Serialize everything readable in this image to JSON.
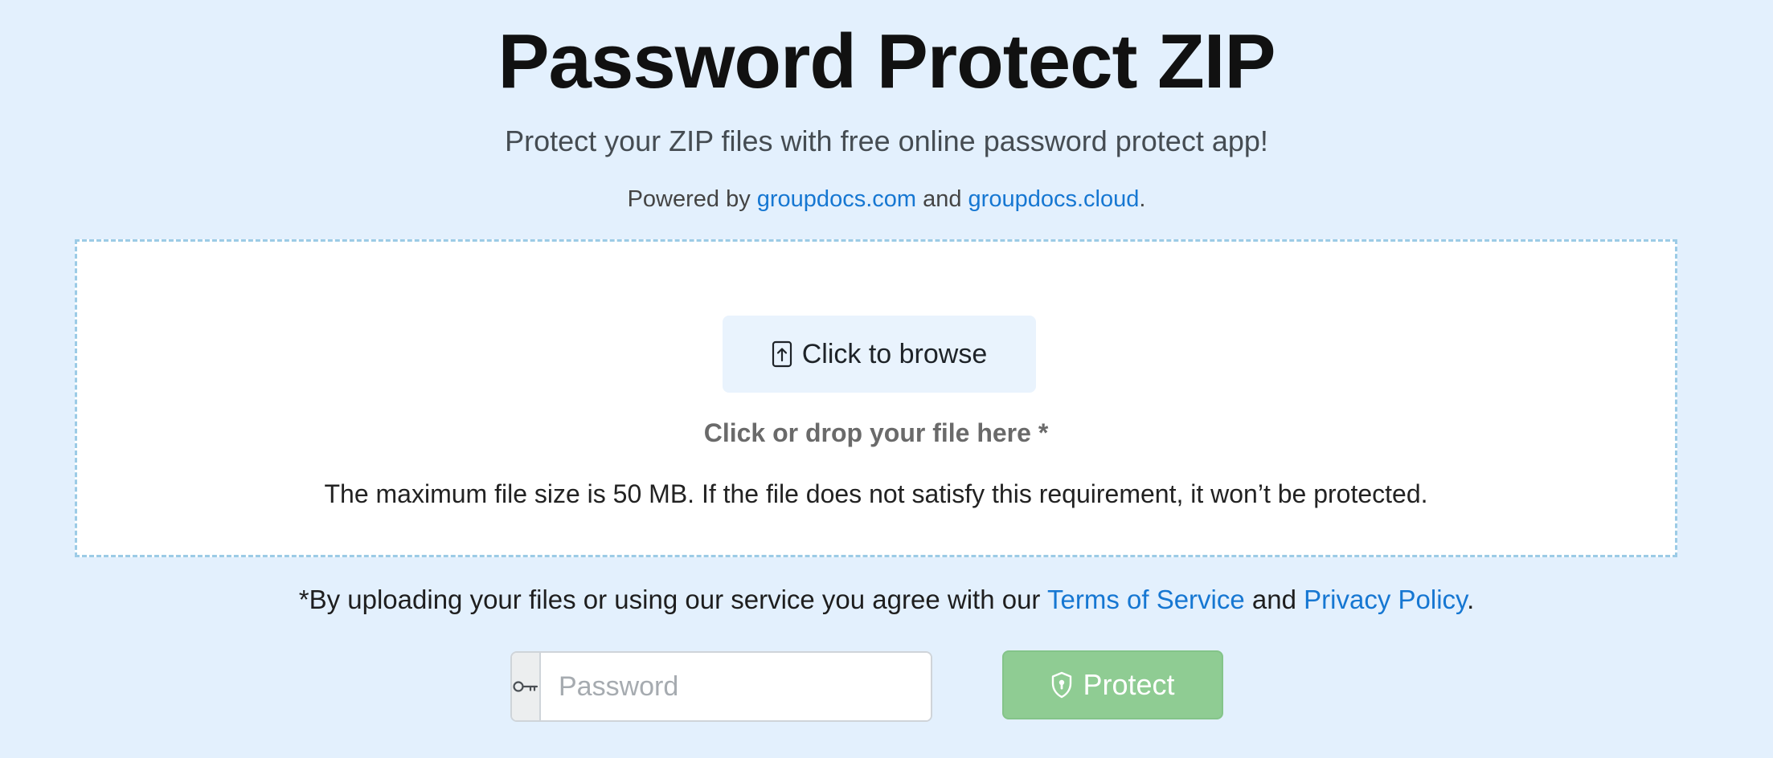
{
  "header": {
    "title": "Password Protect ZIP",
    "subtitle": "Protect your ZIP files with free online password protect app!",
    "powered_prefix": "Powered by ",
    "powered_link1": "groupdocs.com",
    "powered_middle": " and ",
    "powered_link2": "groupdocs.cloud",
    "powered_suffix": "."
  },
  "dropzone": {
    "browse_icon": "upload-file-icon",
    "browse_label": "Click to browse",
    "hint": "Click or drop your file here *",
    "size_note": "The maximum file size is 50 MB. If the file does not satisfy this requirement, it won’t be protected."
  },
  "agreement": {
    "prefix": "*By uploading your files or using our service you agree with our ",
    "terms_link": "Terms of Service",
    "middle": " and ",
    "privacy_link": "Privacy Policy",
    "suffix": "."
  },
  "form": {
    "key_icon": "key-icon",
    "password_placeholder": "Password",
    "password_value": "",
    "protect_icon": "shield-lock-icon",
    "protect_label": "Protect"
  },
  "colors": {
    "background": "#e3f0fd",
    "link": "#1677d2",
    "protect_button": "#8fcc93",
    "dropzone_border": "#9ccbe6"
  }
}
